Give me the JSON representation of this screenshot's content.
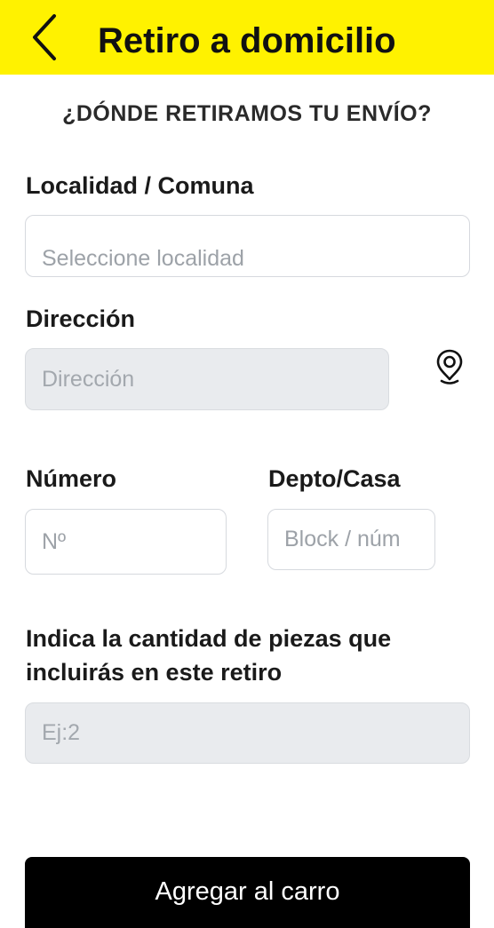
{
  "header": {
    "title": "Retiro a domicilio",
    "background_color": "#fff200",
    "back_icon": "chevron-left-icon"
  },
  "form": {
    "heading": "¿DÓNDE RETIRAMOS TU ENVÍO?",
    "localidad": {
      "label": "Localidad / Comuna",
      "placeholder": "Seleccione localidad",
      "value": ""
    },
    "direccion": {
      "label": "Dirección",
      "placeholder": "Dirección",
      "value": "",
      "map_icon": "map-pin-icon"
    },
    "numero": {
      "label": "Número",
      "placeholder": "Nº",
      "value": ""
    },
    "depto": {
      "label": "Depto/Casa",
      "placeholder": "Block / núm",
      "value": ""
    },
    "piezas": {
      "label_line1": "Indica la cantidad de piezas que",
      "label_line2": "incluirás en este retiro",
      "placeholder": "Ej:2",
      "value": ""
    }
  },
  "cta": {
    "label": "Agregar al carro",
    "background_color": "#000000"
  }
}
